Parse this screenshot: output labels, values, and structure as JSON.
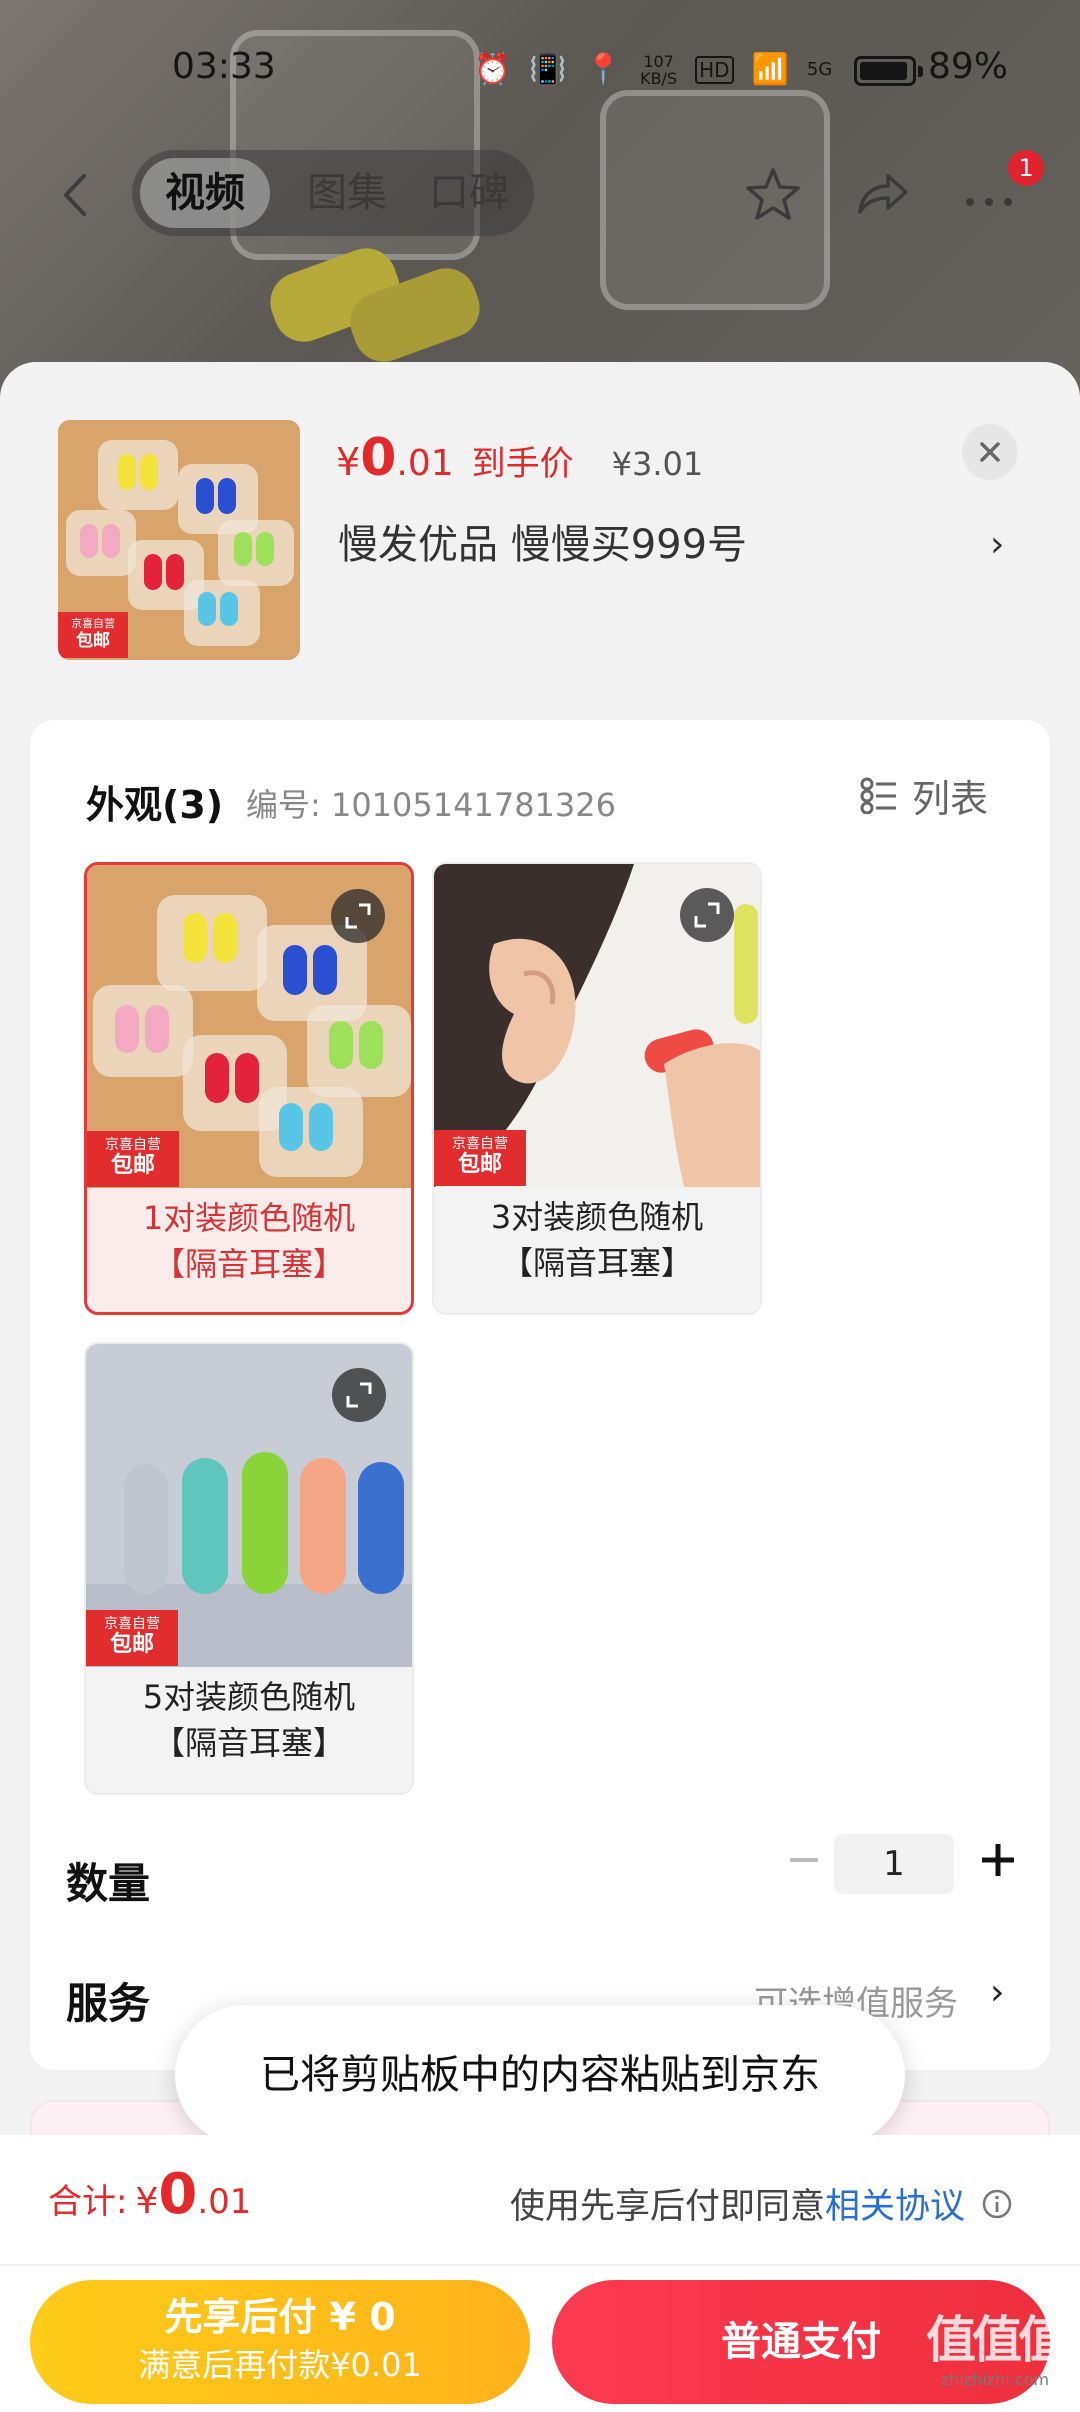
{
  "status_bar": {
    "time": "03:33",
    "net_speed_value": "107",
    "net_speed_unit": "KB/S",
    "hd_label": "HD",
    "signal_label": "5G",
    "battery_percent": "89%"
  },
  "top_nav": {
    "tabs": [
      "视频",
      "图集",
      "口碑"
    ],
    "active_tab": "视频",
    "notification_count": "1"
  },
  "product": {
    "price_yen": "¥",
    "price_int": "0",
    "price_dec": ".01",
    "price_tag": "到手价",
    "original_price": "¥3.01",
    "shop_name": "慢发优品  慢慢买999号",
    "jd_tag_line1": "京喜自营",
    "jd_tag_line2": "包邮"
  },
  "options": {
    "title": "外观(3)",
    "code": "编号: 10105141781326",
    "list_toggle_label": "列表",
    "variants": [
      {
        "line1": "1对装颜色随机",
        "line2": "【隔音耳塞】",
        "selected": true
      },
      {
        "line1": "3对装颜色随机",
        "line2": "【隔音耳塞】",
        "selected": false
      },
      {
        "line1": "5对装颜色随机",
        "line2": "【隔音耳塞】",
        "selected": false
      }
    ]
  },
  "quantity": {
    "label": "数量",
    "value": "1"
  },
  "service": {
    "label": "服务",
    "value": "可选增值服务"
  },
  "toast": {
    "message": "已将剪贴板中的内容粘贴到京东"
  },
  "checkout": {
    "total_label": "合计:",
    "total_yen": "¥",
    "total_int": "0",
    "total_dec": ".01",
    "agreement_text": "使用先享后付即同意",
    "agreement_link": "相关协议",
    "pay_later_line1": "先享后付 ¥ 0",
    "pay_later_line2": "满意后再付款¥0.01",
    "normal_pay_label": "普通支付"
  },
  "watermark": {
    "logo_text": "值值值",
    "site": "zhizhizhi.com"
  },
  "colors": {
    "accent_red": "#e22a2a",
    "link_blue": "#2a6fd6",
    "pay_later_yellow": "#ffc21a"
  }
}
